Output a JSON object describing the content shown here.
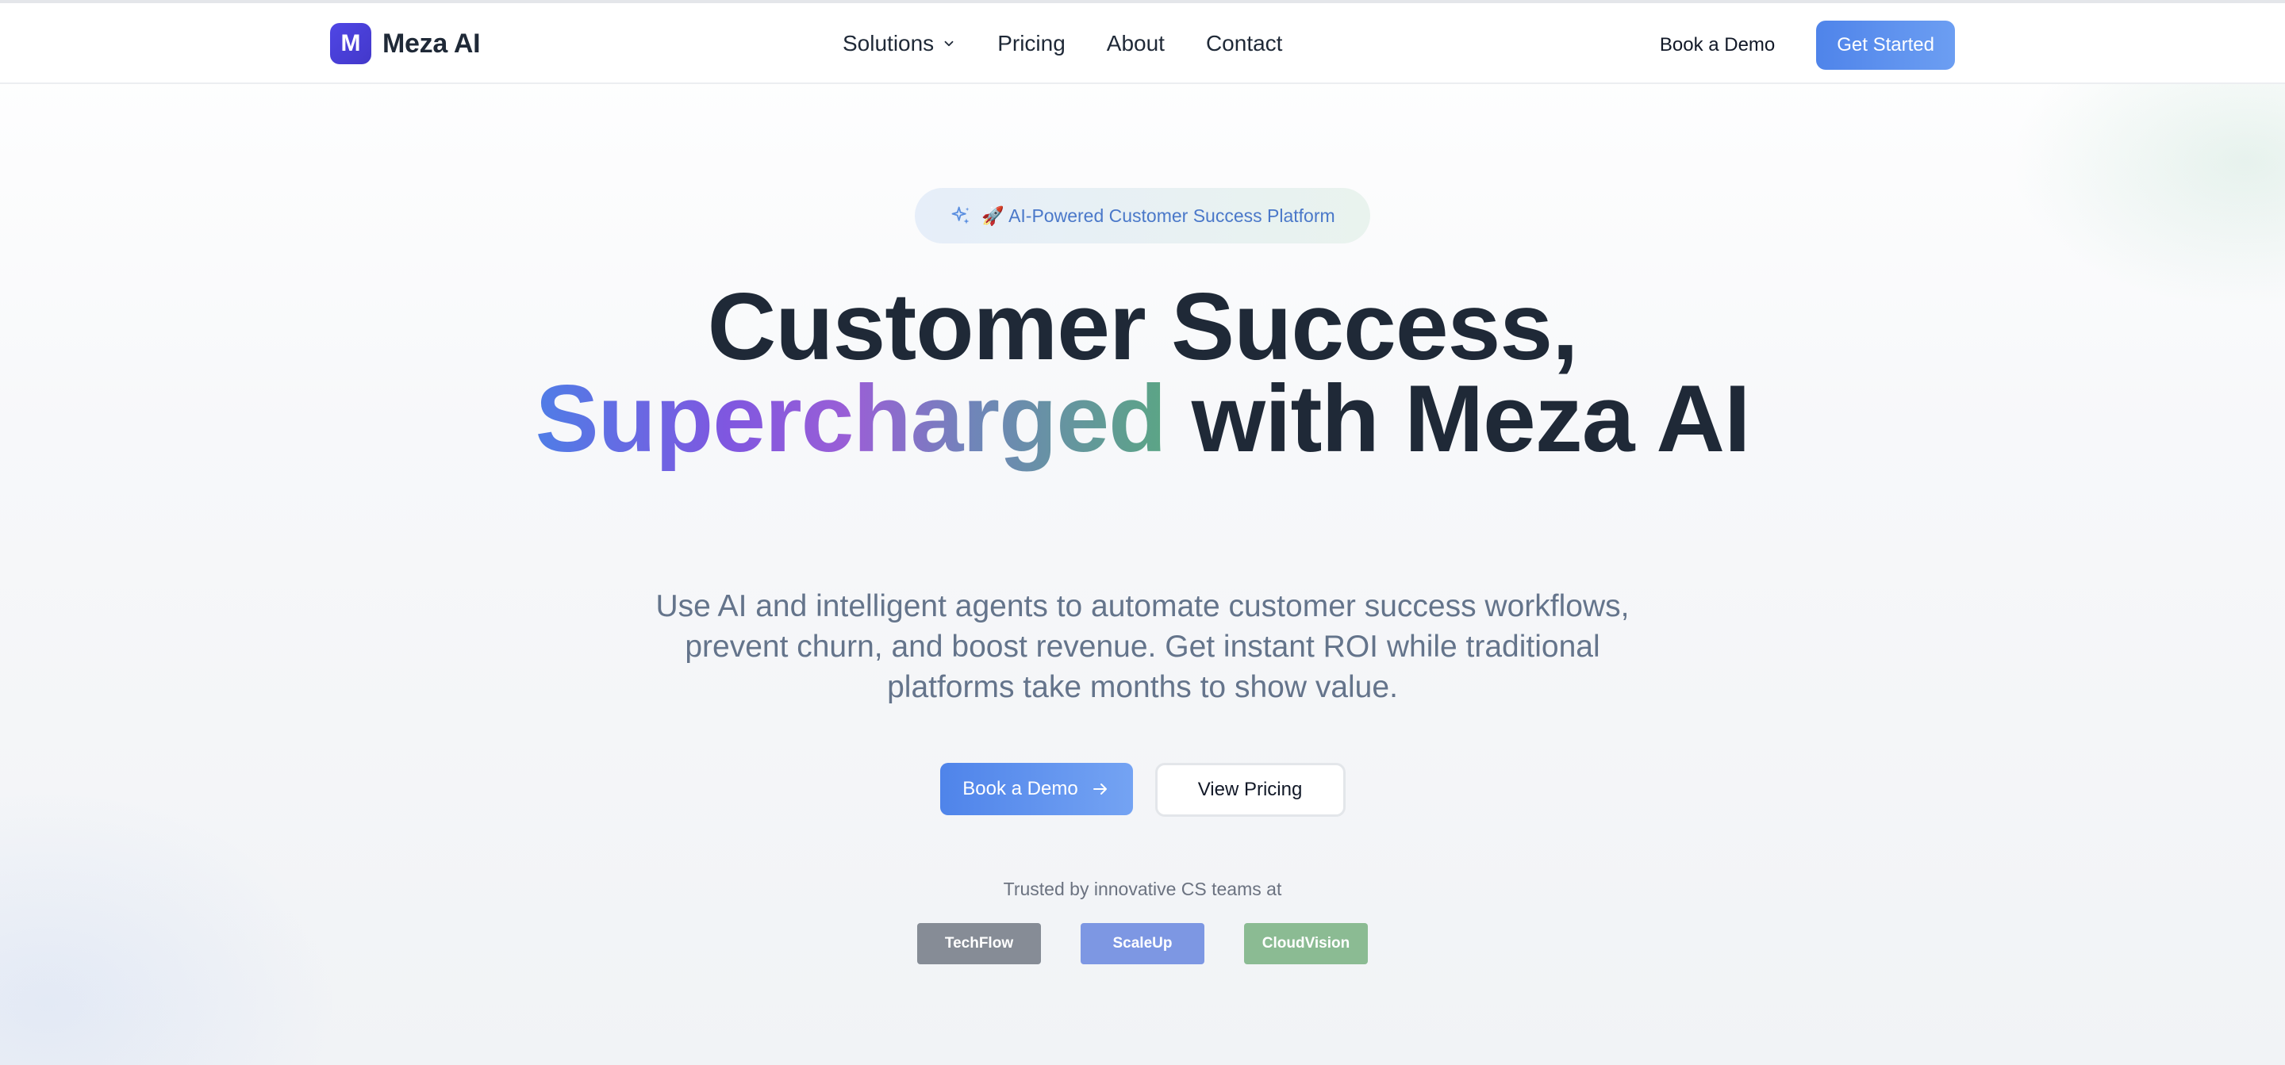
{
  "brand": {
    "mark": "M",
    "name": "Meza AI"
  },
  "nav": {
    "links": [
      {
        "label": "Solutions",
        "has_dropdown": true
      },
      {
        "label": "Pricing"
      },
      {
        "label": "About"
      },
      {
        "label": "Contact"
      }
    ],
    "book_demo": "Book a Demo",
    "get_started": "Get Started"
  },
  "hero": {
    "badge": "🚀 AI-Powered Customer Success Platform",
    "headline_line1": "Customer Success,",
    "headline_gradient": "Supercharged",
    "headline_rest": " with Meza AI",
    "subheadline": "Use AI and intelligent agents to automate customer success workflows, prevent churn, and boost revenue. Get instant ROI while traditional platforms take months to show value.",
    "primary_cta": "Book a Demo",
    "secondary_cta": "View Pricing",
    "trusted_text": "Trusted by innovative CS teams at",
    "customers": [
      {
        "name": "TechFlow",
        "color": "#868c96"
      },
      {
        "name": "ScaleUp",
        "color": "#7d97e3"
      },
      {
        "name": "CloudVision",
        "color": "#8bbb93"
      }
    ]
  },
  "colors": {
    "accent": "#4f84ea",
    "brand_mark": "#4f46e5",
    "text_dark": "#1f2937",
    "text_muted": "#64748b"
  },
  "icons": {
    "badge": "sparkle-icon",
    "dropdown": "chevron-down-icon",
    "cta": "arrow-right-icon"
  }
}
